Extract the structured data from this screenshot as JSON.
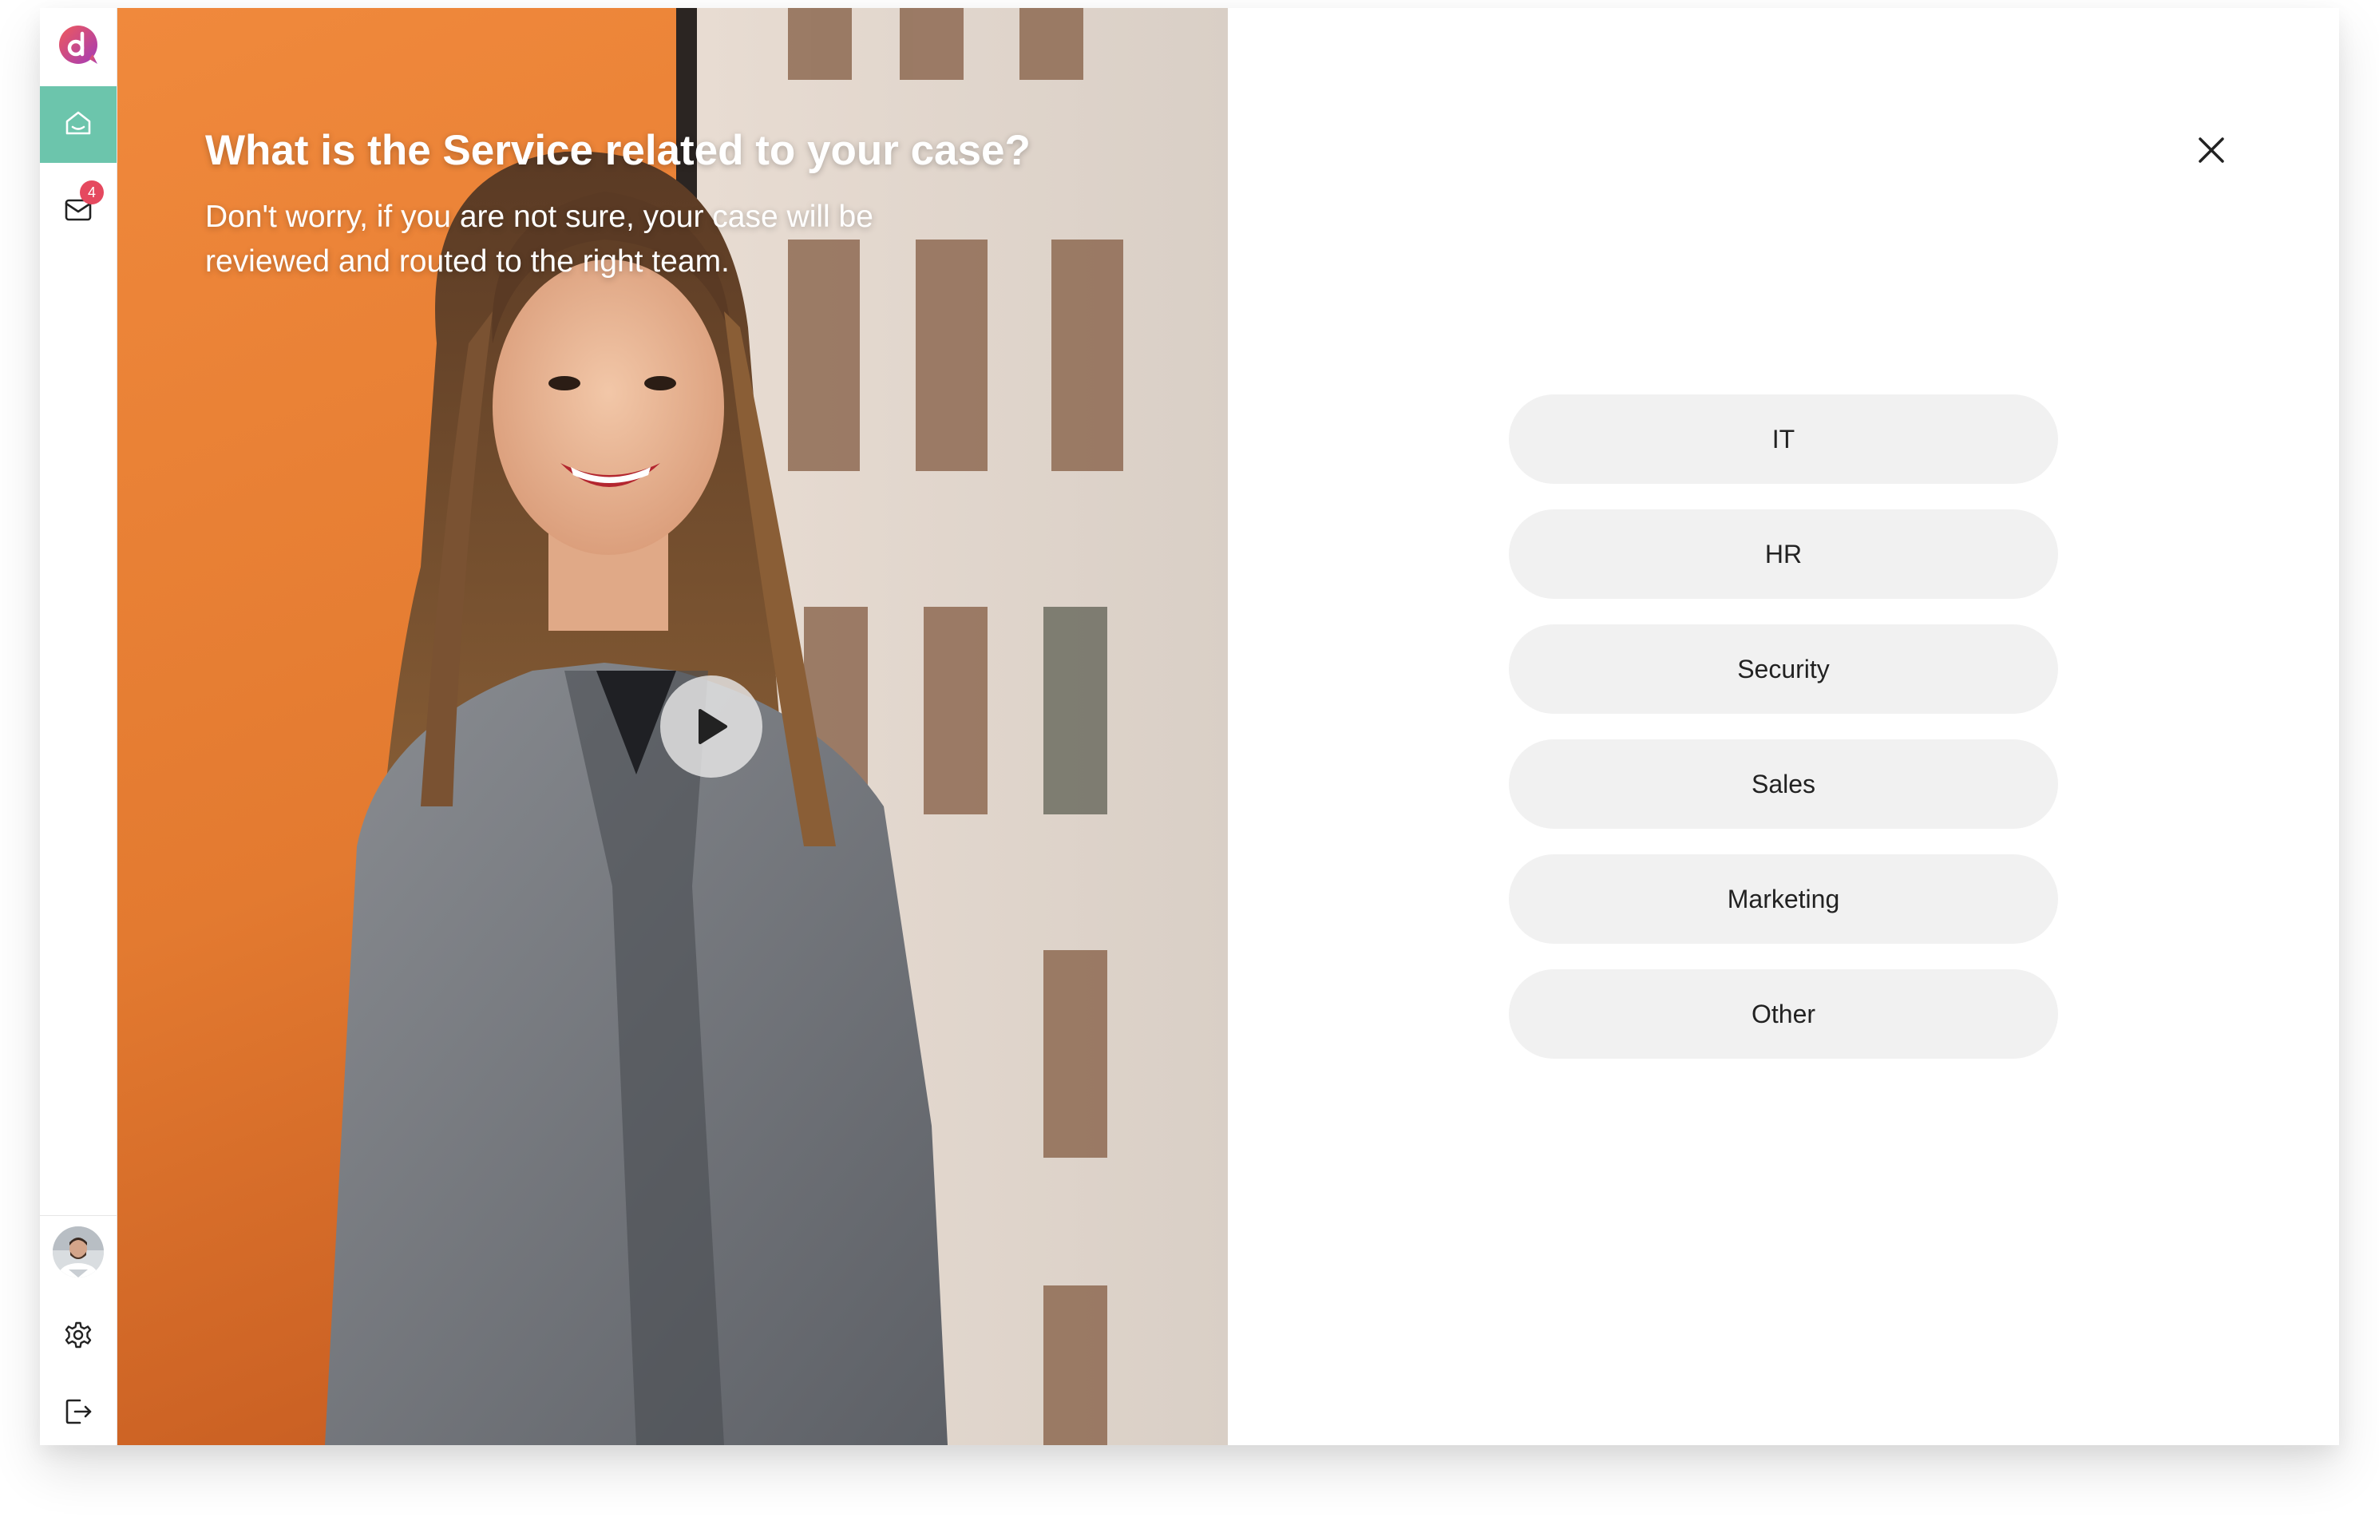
{
  "sidebar": {
    "logo": {
      "icon": "app-logo-icon",
      "letter": "d",
      "color_gradient": [
        "#e5495f",
        "#9b3bb5"
      ]
    },
    "items": [
      {
        "icon": "home-icon",
        "active": true
      },
      {
        "icon": "inbox-icon",
        "badge": "4"
      }
    ],
    "bottom": [
      {
        "icon": "user-avatar"
      },
      {
        "icon": "gear-icon"
      },
      {
        "icon": "logout-icon"
      }
    ],
    "accent_color": "#6cc5ac",
    "badge_color": "#e5495f"
  },
  "hero": {
    "title": "What is the Service related to your case?",
    "subtitle": "Don't worry, if you are not sure, your case will be reviewed and routed to the right team.",
    "play_icon": "play-icon"
  },
  "dialog": {
    "close_icon": "close-icon",
    "options": [
      {
        "label": "IT"
      },
      {
        "label": "HR"
      },
      {
        "label": "Security"
      },
      {
        "label": "Sales"
      },
      {
        "label": "Marketing"
      },
      {
        "label": "Other"
      }
    ],
    "option_bg": "#f1f1f1"
  }
}
